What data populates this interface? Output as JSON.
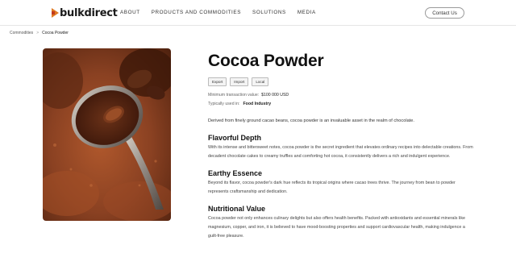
{
  "header": {
    "logo_text": "bulkdirect",
    "nav": [
      "ABOUT",
      "PRODUCTS AND COMMODITIES",
      "SOLUTIONS",
      "MEDIA"
    ],
    "contact_label": "Contact Us"
  },
  "breadcrumb": {
    "parent": "Commodities",
    "separator": ">",
    "current": "Cocoa Powder"
  },
  "product": {
    "title": "Cocoa Powder",
    "tags": [
      "Export",
      "Import",
      "Local"
    ],
    "min_label": "Minimum transaction value:",
    "min_value": "$100 000 USD",
    "used_label": "Typically used in:",
    "used_value": "Food Industry",
    "intro": "Derived from finely ground cacao beans, cocoa powder is an invaluable asset in the realm of chocolate."
  },
  "sections": [
    {
      "heading": "Flavorful Depth",
      "body": "With its intense and bittersweet notes, cocoa powder is the secret ingredient that elevates ordinary recipes into delectable creations. From decadent chocolate cakes to creamy truffles and comforting hot cocoa, it consistently delivers a rich and indulgent experience."
    },
    {
      "heading": "Earthy Essence",
      "body": "Beyond its flavor, cocoa powder's dark hue reflects its tropical origins where cacao trees thrive. The journey from bean to powder represents craftsmanship and dedication."
    },
    {
      "heading": "Nutritional Value",
      "body": "Cocoa powder not only enhances culinary delights but also offers health benefits. Packed with antioxidants and essential minerals like magnesium, copper, and iron, it is believed to have mood-boosting properties and support cardiovascular health, making indulgence a guilt-free pleasure."
    }
  ],
  "colors": {
    "logo_orange": "#e07a22",
    "cocoa_dark": "#5a2a14",
    "cocoa_mid": "#8a4526"
  }
}
